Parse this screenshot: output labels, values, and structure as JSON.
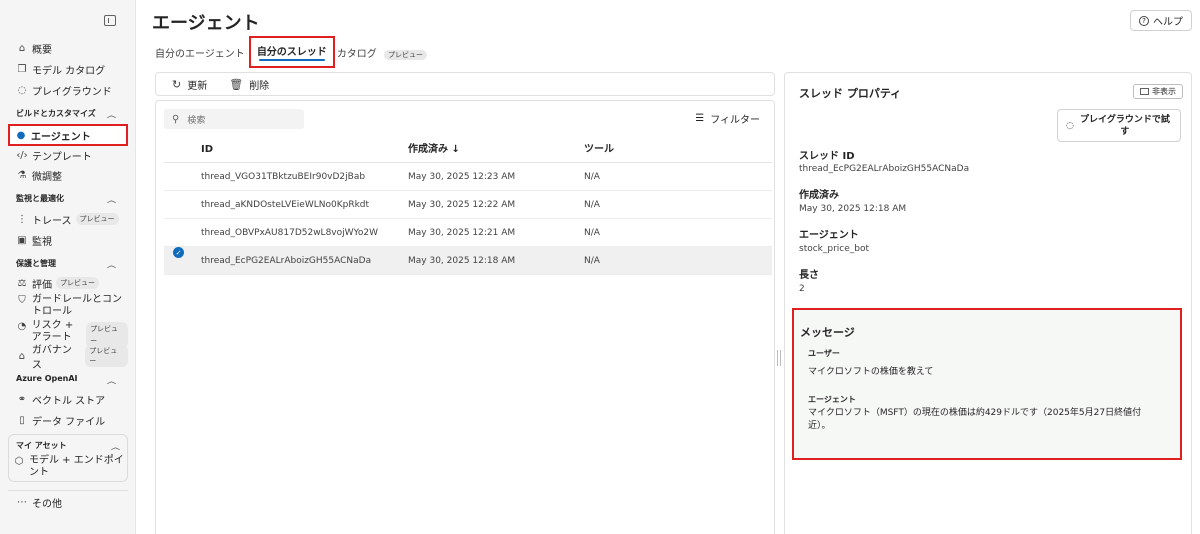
{
  "sidebar": {
    "items": {
      "overview": "概要",
      "model_catalog": "モデル カタログ",
      "playground": "プレイグラウンド",
      "agents": "エージェント",
      "templates": "テンプレート",
      "finetune": "微調整",
      "trace": "トレース",
      "monitor": "監視",
      "evaluation": "評価",
      "guardrails": "ガードレールとコントロール",
      "risk_alert": "リスク + アラート",
      "governance": "ガバナンス",
      "vector_store": "ベクトル ストア",
      "data_files": "データ ファイル",
      "models_endpoints": "モデル + エンドポイント",
      "more": "その他"
    },
    "groups": {
      "build": "ビルドとカスタマイズ",
      "monitor": "監視と最適化",
      "protect": "保護と管理",
      "azure_openai": "Azure OpenAI",
      "my_assets": "マイ アセット"
    },
    "preview_badge": "プレビュー"
  },
  "header": {
    "title": "エージェント",
    "help": "ヘルプ"
  },
  "tabs": {
    "my_agents": "自分のエージェント",
    "my_threads": "自分のスレッド",
    "catalog": "カタログ",
    "catalog_badge": "プレビュー"
  },
  "toolbar": {
    "refresh": "更新",
    "delete": "削除"
  },
  "list": {
    "search_placeholder": "検索",
    "filter": "フィルター",
    "columns": {
      "id": "ID",
      "created": "作成済み ↓",
      "tools": "ツール"
    },
    "rows": [
      {
        "id": "thread_VGO31TBktzuBEIr90vD2jBab",
        "created": "May 30, 2025 12:23 AM",
        "tools": "N/A"
      },
      {
        "id": "thread_aKNDOsteLVEieWLNo0KpRkdt",
        "created": "May 30, 2025 12:22 AM",
        "tools": "N/A"
      },
      {
        "id": "thread_OBVPxAU817D52wL8vojWYo2W",
        "created": "May 30, 2025 12:21 AM",
        "tools": "N/A"
      },
      {
        "id": "thread_EcPG2EALrAboizGH55ACNaDa",
        "created": "May 30, 2025 12:18 AM",
        "tools": "N/A"
      }
    ]
  },
  "properties": {
    "title": "スレッド プロパティ",
    "hide": "非表示",
    "try_playground": "プレイグラウンドで試す",
    "thread_id_label": "スレッド ID",
    "thread_id": "thread_EcPG2EALrAboizGH55ACNaDa",
    "created_label": "作成済み",
    "created": "May 30, 2025 12:18 AM",
    "agent_label": "エージェント",
    "agent": "stock_price_bot",
    "length_label": "長さ",
    "length": "2",
    "messages_title": "メッセージ",
    "user_role": "ユーザー",
    "user_message": "マイクロソフトの株価を教えて",
    "agent_role": "エージェント",
    "agent_message": "マイクロソフト（MSFT）の現在の株価は約429ドルです（2025年5月27日終値付近）。"
  }
}
